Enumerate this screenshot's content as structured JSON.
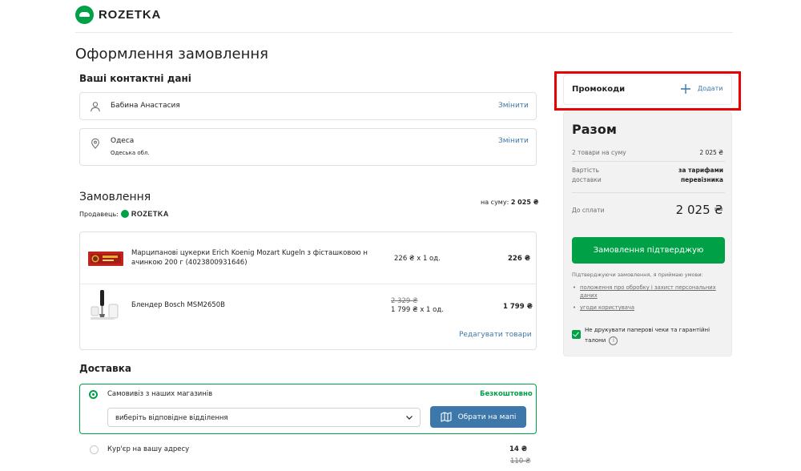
{
  "header": {
    "brand": "ROZETKA"
  },
  "page_title": "Оформлення замовлення",
  "contacts": {
    "title": "Ваші контактні дані",
    "person": {
      "name": "Бабина Анастасия",
      "change": "Змінити",
      "icon": "user-icon"
    },
    "location": {
      "city": "Одеса",
      "region": "Одеська обл.",
      "change": "Змінити",
      "icon": "map-pin-icon"
    }
  },
  "order": {
    "title": "Замовлення",
    "seller_label": "Продавець:",
    "seller_name": "ROZETKA",
    "sum_label": "на суму:",
    "sum_value": "2 025 ₴",
    "items": [
      {
        "name": "Марципанові цукерки Erich Koenig Mozart Kugeln з фісташковою н ачинкою 200 г (4023800931646)",
        "qty": "226 ₴ х 1 од.",
        "total": "226 ₴"
      },
      {
        "name": "Блендер Bosch MSM2650B",
        "old_price": "2 329 ₴",
        "qty": "1 799 ₴ х 1 од.",
        "total": "1 799 ₴"
      }
    ],
    "edit_link": "Редагувати товари"
  },
  "delivery": {
    "title": "Доставка",
    "options": [
      {
        "label": "Самовивіз з наших магазинів",
        "price": "Безкоштовно",
        "selected": true
      },
      {
        "label": "Кур'єр на вашу адресу",
        "price": "14 ₴",
        "old_price": "110 ₴",
        "selected": false
      }
    ],
    "select_value": "виберіть відповідне відділення",
    "map_button": "Обрати на мапі"
  },
  "promo": {
    "label": "Промокоди",
    "add": "Додати"
  },
  "summary": {
    "title": "Разом",
    "items_label": "2 товари на суму",
    "items_value": "2 025 ₴",
    "delivery_label": "Вартість доставки",
    "delivery_value": "за тарифами перевізника",
    "pay_label": "До сплати",
    "pay_value": "2 025 ₴",
    "confirm": "Замовлення підтверджую",
    "terms_intro": "Підтверджуючи замовлення, я приймаю умови:",
    "terms": [
      "положення про обробку і захист персональних даних",
      "угоди користувача"
    ],
    "no_paper": "Не друкувати паперові чеки та гарантійні талони"
  },
  "colors": {
    "accent": "#00a046",
    "link": "#3e77aa",
    "highlight": "#e60000"
  }
}
